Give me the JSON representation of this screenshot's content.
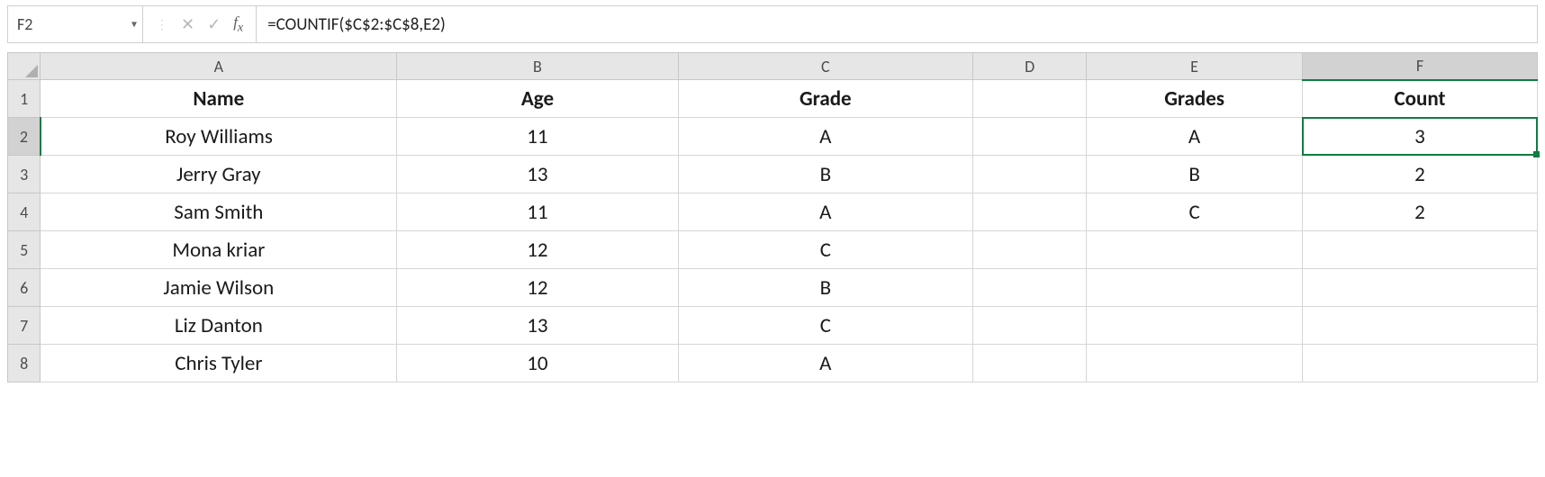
{
  "formula_bar": {
    "cell_ref": "F2",
    "formula": "=COUNTIF($C$2:$C$8,E2)"
  },
  "columns": [
    "A",
    "B",
    "C",
    "D",
    "E",
    "F"
  ],
  "row_numbers": [
    "1",
    "2",
    "3",
    "4",
    "5",
    "6",
    "7",
    "8"
  ],
  "selected_column": "F",
  "selected_row": "2",
  "header_row": {
    "A": "Name",
    "B": "Age",
    "C": "Grade",
    "D": "",
    "E": "Grades",
    "F": "Count"
  },
  "data_rows": [
    {
      "A": "Roy Williams",
      "B": "11",
      "C": "A",
      "D": "",
      "E": "A",
      "F": "3"
    },
    {
      "A": "Jerry Gray",
      "B": "13",
      "C": "B",
      "D": "",
      "E": "B",
      "F": "2"
    },
    {
      "A": "Sam Smith",
      "B": "11",
      "C": "A",
      "D": "",
      "E": "C",
      "F": "2"
    },
    {
      "A": "Mona kriar",
      "B": "12",
      "C": "C",
      "D": "",
      "E": "",
      "F": ""
    },
    {
      "A": "Jamie Wilson",
      "B": "12",
      "C": "B",
      "D": "",
      "E": "",
      "F": ""
    },
    {
      "A": "Liz Danton",
      "B": "13",
      "C": "C",
      "D": "",
      "E": "",
      "F": ""
    },
    {
      "A": "Chris Tyler",
      "B": "10",
      "C": "A",
      "D": "",
      "E": "",
      "F": ""
    }
  ]
}
